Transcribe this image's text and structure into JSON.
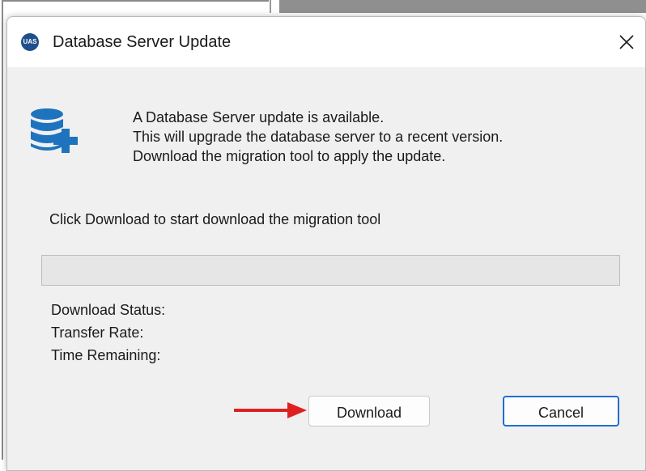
{
  "window": {
    "title": "Database Server Update",
    "app_icon_text": "UAS"
  },
  "message": {
    "line1": "A Database Server update is available.",
    "line2": "This will upgrade the database server to a recent version.",
    "line3": "Download the migration tool to apply the update."
  },
  "instruction": "Click Download to start download the migration tool",
  "progress": {
    "value": 0
  },
  "status": {
    "download_status_label": "Download Status:",
    "transfer_rate_label": "Transfer Rate:",
    "time_remaining_label": "Time Remaining:"
  },
  "buttons": {
    "download": "Download",
    "cancel": "Cancel"
  },
  "colors": {
    "annotation_arrow": "#e02020",
    "cancel_focus_border": "#1f6fcf",
    "db_icon_blue": "#1e73be"
  },
  "icons": {
    "app": "uas-logo-icon",
    "close": "close-icon",
    "database": "database-add-icon",
    "arrow": "red-arrow-icon"
  }
}
